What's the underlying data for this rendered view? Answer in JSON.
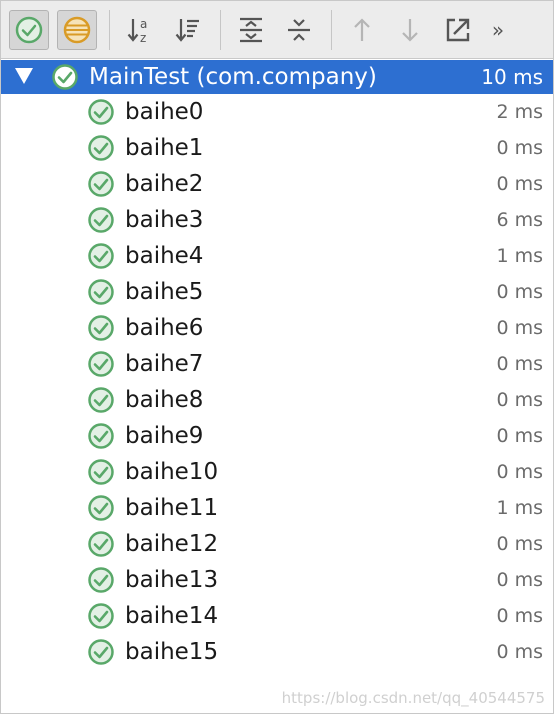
{
  "toolbar": {
    "buttons": [
      {
        "icon": "show-passed-icon",
        "toggled": true
      },
      {
        "icon": "show-ignored-icon",
        "toggled": true
      },
      {
        "icon": "sort-alphabetically-icon"
      },
      {
        "icon": "sort-by-duration-icon"
      },
      {
        "icon": "expand-all-icon"
      },
      {
        "icon": "collapse-all-icon"
      },
      {
        "icon": "previous-failed-icon"
      },
      {
        "icon": "next-failed-icon"
      },
      {
        "icon": "export-icon"
      }
    ],
    "more_label": "»"
  },
  "colors": {
    "selection": "#2d6fd1",
    "passed": "#59a869",
    "ignored": "#d99b26"
  },
  "tree": {
    "root": {
      "label": "MainTest (com.company)",
      "duration": "10 ms",
      "status": "passed",
      "expanded": true
    },
    "tests": [
      {
        "label": "baihe0",
        "duration": "2 ms",
        "status": "passed"
      },
      {
        "label": "baihe1",
        "duration": "0 ms",
        "status": "passed"
      },
      {
        "label": "baihe2",
        "duration": "0 ms",
        "status": "passed"
      },
      {
        "label": "baihe3",
        "duration": "6 ms",
        "status": "passed"
      },
      {
        "label": "baihe4",
        "duration": "1 ms",
        "status": "passed"
      },
      {
        "label": "baihe5",
        "duration": "0 ms",
        "status": "passed"
      },
      {
        "label": "baihe6",
        "duration": "0 ms",
        "status": "passed"
      },
      {
        "label": "baihe7",
        "duration": "0 ms",
        "status": "passed"
      },
      {
        "label": "baihe8",
        "duration": "0 ms",
        "status": "passed"
      },
      {
        "label": "baihe9",
        "duration": "0 ms",
        "status": "passed"
      },
      {
        "label": "baihe10",
        "duration": "0 ms",
        "status": "passed"
      },
      {
        "label": "baihe11",
        "duration": "1 ms",
        "status": "passed"
      },
      {
        "label": "baihe12",
        "duration": "0 ms",
        "status": "passed"
      },
      {
        "label": "baihe13",
        "duration": "0 ms",
        "status": "passed"
      },
      {
        "label": "baihe14",
        "duration": "0 ms",
        "status": "passed"
      },
      {
        "label": "baihe15",
        "duration": "0 ms",
        "status": "passed"
      }
    ]
  },
  "watermark": "https://blog.csdn.net/qq_40544575"
}
